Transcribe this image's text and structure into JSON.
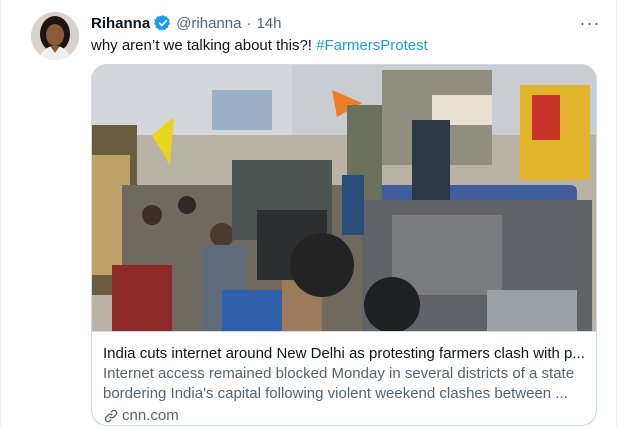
{
  "tweet": {
    "display_name": "Rihanna",
    "handle": "@rihanna",
    "separator": "·",
    "time": "14h",
    "more_glyph": "···",
    "text": "why aren’t we talking about this?! ",
    "hashtag": "#FarmersProtest"
  },
  "card": {
    "title": "India cuts internet around New Delhi as protesting farmers clash with p...",
    "description": "Internet access remained blocked Monday in several districts of a state bordering India's capital following violent weekend clashes between ...",
    "domain": "cnn.com"
  },
  "colors": {
    "accent": "#1d9bf0",
    "secondary_text": "#536471",
    "border": "#cfd9de"
  },
  "icons": {
    "verified": "verified-badge-icon",
    "more": "more-options-icon",
    "link": "link-icon"
  }
}
